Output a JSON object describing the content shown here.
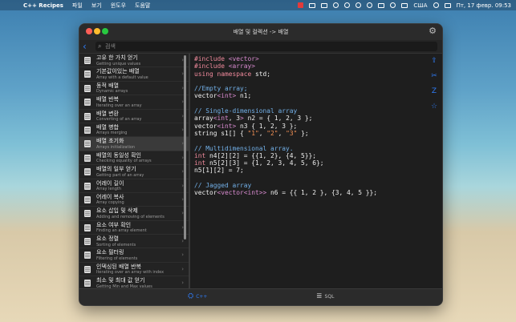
{
  "menubar": {
    "app_name": "C++ Recipes",
    "menus": [
      "파일",
      "보기",
      "윈도우",
      "도움말"
    ],
    "lang": "США",
    "datetime": "Пт, 17 февр.  09:53"
  },
  "window": {
    "title": "배열 및 컬렉션 -> 배열",
    "search_placeholder": "검색"
  },
  "sidebar": {
    "items": [
      {
        "title": "고유 한 가치 얻기",
        "subtitle": "Getting unique values"
      },
      {
        "title": "기본값이있는 배열",
        "subtitle": "Array with a default value"
      },
      {
        "title": "동적 배열",
        "subtitle": "Dynamic arrays"
      },
      {
        "title": "배열 반복",
        "subtitle": "Iterating over an array"
      },
      {
        "title": "배열 변환",
        "subtitle": "Converting of an array"
      },
      {
        "title": "배열 병합",
        "subtitle": "Arrays merging"
      },
      {
        "title": "배열 초기화",
        "subtitle": "Arrays initialization"
      },
      {
        "title": "배열의 동일성 확인",
        "subtitle": "Checking equality of arrays"
      },
      {
        "title": "배열의 일부 얻기",
        "subtitle": "Getting part of an array"
      },
      {
        "title": "어레이 길이",
        "subtitle": "Array length"
      },
      {
        "title": "어레이 복사",
        "subtitle": "Array copying"
      },
      {
        "title": "요소 삽입 및 삭제",
        "subtitle": "Adding and removing of elements"
      },
      {
        "title": "요소 여부 확인",
        "subtitle": "Finding an array element"
      },
      {
        "title": "요소 정렬",
        "subtitle": "Sorting of elements"
      },
      {
        "title": "요소 필터링",
        "subtitle": "Filtering of elements"
      },
      {
        "title": "인덱싱된 배열 반복",
        "subtitle": "Iterating over an array with index"
      },
      {
        "title": "최소 및 최대 값 얻기",
        "subtitle": "Getting Min and Max values"
      }
    ],
    "selected_index": 6
  },
  "code_lines": [
    [
      [
        "inc",
        "#include "
      ],
      [
        "ang",
        "<vector>"
      ]
    ],
    [
      [
        "inc",
        "#include "
      ],
      [
        "ang",
        "<array>"
      ]
    ],
    [
      [
        "kw",
        "using namespace "
      ],
      [
        "txt",
        "std;"
      ]
    ],
    [
      [
        "txt",
        ""
      ]
    ],
    [
      [
        "cm",
        "//Empty array;"
      ]
    ],
    [
      [
        "txt",
        "vector"
      ],
      [
        "ang",
        "<int>"
      ],
      [
        "txt",
        " n1;"
      ]
    ],
    [
      [
        "txt",
        ""
      ]
    ],
    [
      [
        "cm",
        "// Single-dimensional array"
      ]
    ],
    [
      [
        "txt",
        "array"
      ],
      [
        "ang",
        "<int"
      ],
      [
        "txt",
        ", 3"
      ],
      [
        "ang",
        ">"
      ],
      [
        "txt",
        " n2 = { 1, 2, 3 };"
      ]
    ],
    [
      [
        "txt",
        "vector"
      ],
      [
        "ang",
        "<int>"
      ],
      [
        "txt",
        " n3 { 1, 2, 3 };"
      ]
    ],
    [
      [
        "txt",
        "string s1[] { "
      ],
      [
        "str",
        "\"1\""
      ],
      [
        "txt",
        ", "
      ],
      [
        "str",
        "\"2\""
      ],
      [
        "txt",
        ", "
      ],
      [
        "str",
        "\"3\""
      ],
      [
        "txt",
        " };"
      ]
    ],
    [
      [
        "txt",
        ""
      ]
    ],
    [
      [
        "cm",
        "// Multidimensional array."
      ]
    ],
    [
      [
        "kw",
        "int"
      ],
      [
        "txt",
        " n4[2][2] = {{1, 2}, {4, 5}};"
      ]
    ],
    [
      [
        "kw",
        "int"
      ],
      [
        "txt",
        " n5[2][3] = {1, 2, 3, 4, 5, 6};"
      ]
    ],
    [
      [
        "txt",
        "n5[1][2] = 7;"
      ]
    ],
    [
      [
        "txt",
        ""
      ]
    ],
    [
      [
        "cm",
        "// Jagged array"
      ]
    ],
    [
      [
        "txt",
        "vector"
      ],
      [
        "ang",
        "<vector<int>>"
      ],
      [
        "txt",
        " n6 = {{ 1, 2 }, {3, 4, 5 }};"
      ]
    ]
  ],
  "tabs": [
    {
      "label": "C++",
      "icon": "cpp-icon"
    },
    {
      "label": "SQL",
      "icon": "database-icon"
    }
  ],
  "colors": {
    "accent": "#2f7cf6",
    "keyword": "#f08a9c",
    "comment": "#72b0e8",
    "string": "#f29055"
  }
}
